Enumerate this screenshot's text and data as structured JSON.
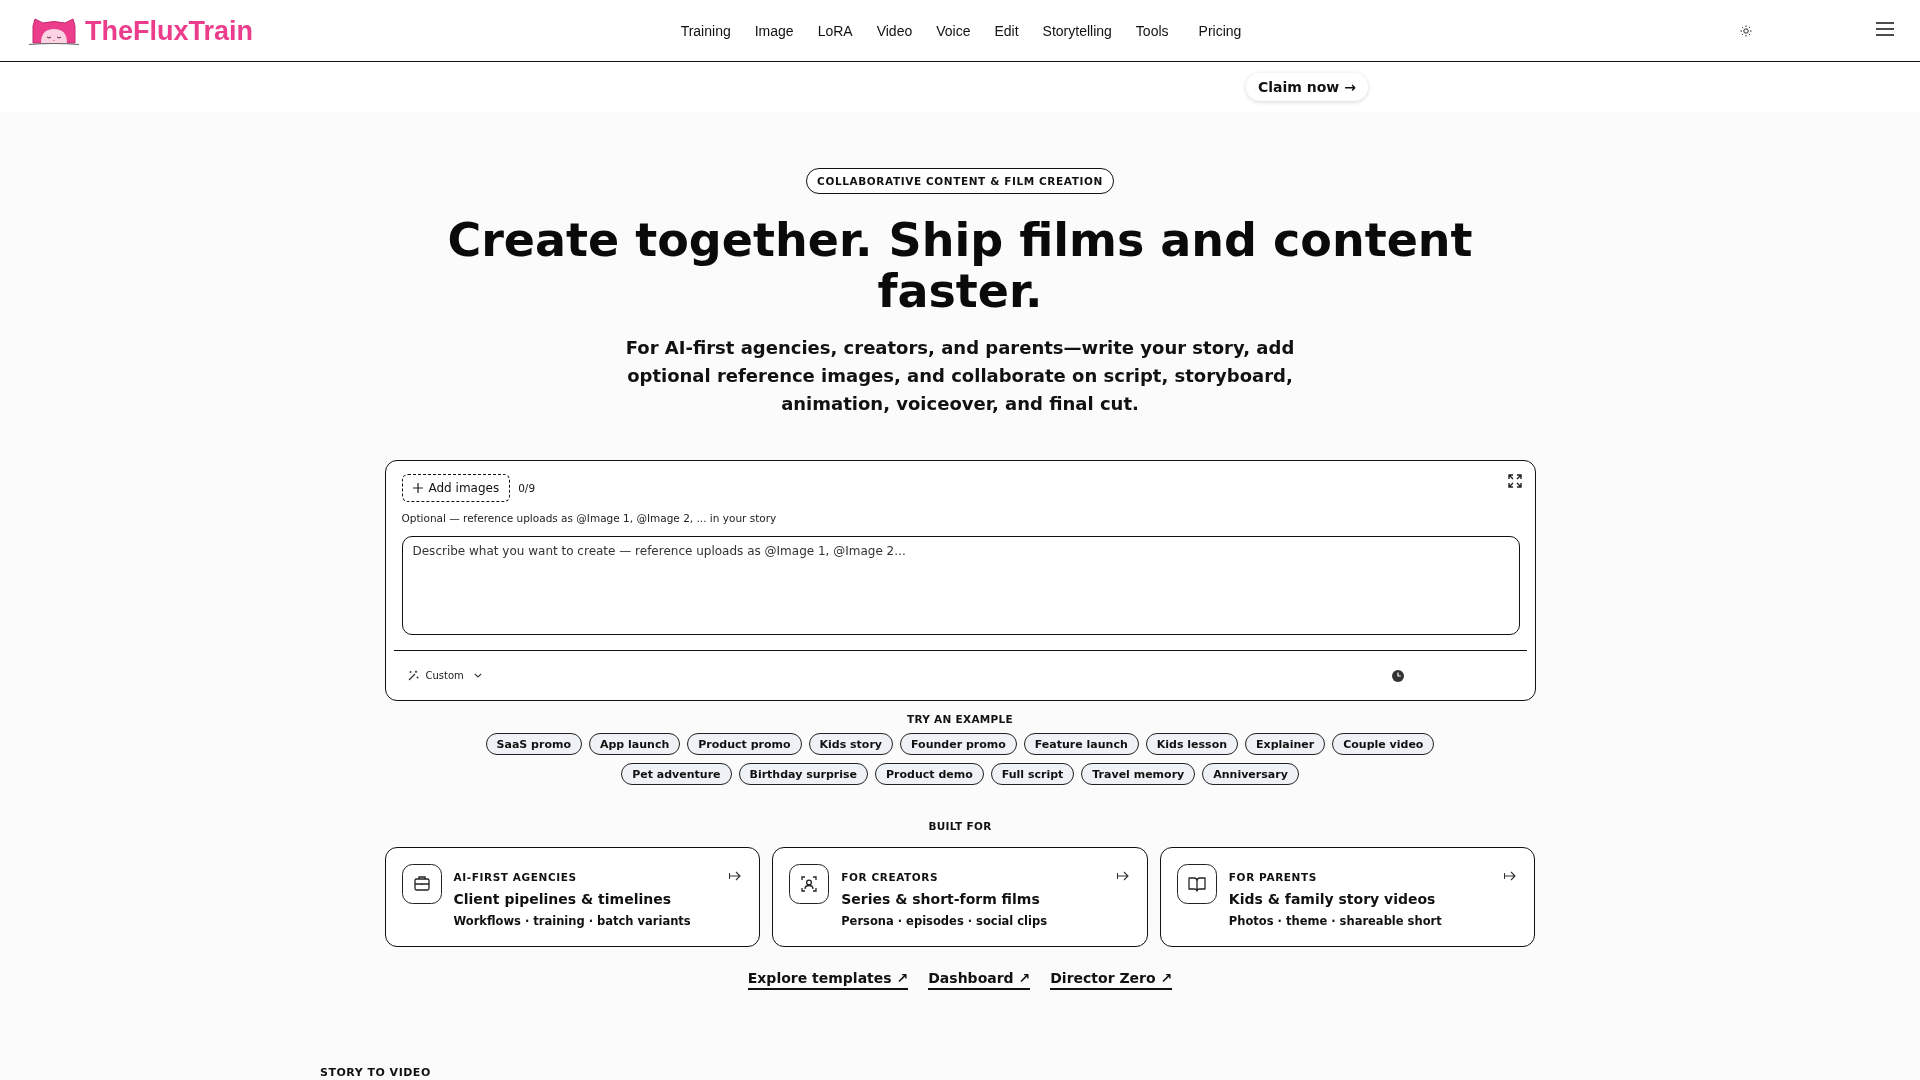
{
  "header": {
    "brand": "TheFluxTrain",
    "nav": [
      "Training",
      "Image",
      "LoRA",
      "Video",
      "Voice",
      "Edit",
      "Storytelling",
      "Tools",
      "Pricing"
    ]
  },
  "promo": {
    "button": "Claim now →"
  },
  "hero": {
    "badge": "COLLABORATIVE CONTENT & FILM CREATION",
    "title": "Create together. Ship films and content faster.",
    "subtitle": "For AI-first agencies, creators, and parents—write your story, add optional reference images, and collaborate on script, storyboard, animation, voiceover, and final cut."
  },
  "composer": {
    "add_button": "Add images",
    "image_count": "0/9",
    "hint": "Optional — reference uploads as @Image 1, @Image 2, ... in your story",
    "prompt": {
      "placeholder": "Describe what you want to create — reference uploads as @Image 1, @Image 2..."
    },
    "mode": "Custom"
  },
  "examples": {
    "title": "TRY AN EXAMPLE",
    "items": [
      "SaaS promo",
      "App launch",
      "Product promo",
      "Kids story",
      "Founder promo",
      "Feature launch",
      "Kids lesson",
      "Explainer",
      "Couple video",
      "Pet adventure",
      "Birthday surprise",
      "Product demo",
      "Full script",
      "Travel memory",
      "Anniversary"
    ]
  },
  "built_for": {
    "title": "BUILT FOR",
    "cards": [
      {
        "kind": "agencies",
        "eyebrow": "AI-FIRST AGENCIES",
        "title": "Client pipelines & timelines",
        "details": "Workflows · training · batch variants"
      },
      {
        "kind": "creators",
        "eyebrow": "FOR CREATORS",
        "title": "Series & short-form films",
        "details": "Persona · episodes · social clips"
      },
      {
        "kind": "parents",
        "eyebrow": "FOR PARENTS",
        "title": "Kids & family story videos",
        "details": "Photos · theme · shareable short"
      }
    ]
  },
  "links": [
    "Explore templates ↗",
    "Dashboard ↗",
    "Director Zero ↗"
  ],
  "next_section": {
    "title": "STORY TO VIDEO"
  }
}
